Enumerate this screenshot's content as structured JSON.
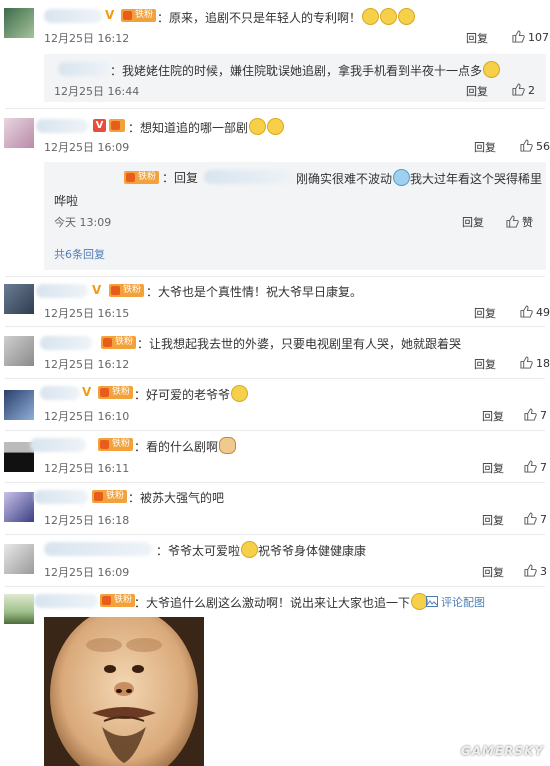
{
  "comments": [
    {
      "text": "：原来，追剧不只是年轻人的专利啊！",
      "time": "12月25日 16:12",
      "reply": "回复",
      "likes": "107"
    },
    {
      "sub_text": "：我姥姥住院的时候，嫌住院耽误她追剧，拿我手机看到半夜十一点多",
      "sub_time": "12月25日 16:44",
      "reply": "回复",
      "likes": "2"
    },
    {
      "text": "：想知道追的哪一部剧",
      "time": "12月25日 16:09",
      "reply": "回复",
      "likes": "56"
    },
    {
      "sub_line1_a": "：回复",
      "sub_line1_b": "刚确实很难不波动",
      "sub_line1_c": "我大过年看这个哭得稀里",
      "sub_line2": "哗啦",
      "sub_time": "今天 13:09",
      "reply": "回复",
      "likes": "赞",
      "more": "共6条回复"
    },
    {
      "text": "：大爷也是个真性情！祝大爷早日康复。",
      "time": "12月25日 16:15",
      "reply": "回复",
      "likes": "49"
    },
    {
      "text": "：让我想起我去世的外婆，只要电视剧里有人哭，她就跟着哭",
      "time": "12月25日 16:12",
      "reply": "回复",
      "likes": "18"
    },
    {
      "text": "：好可爱的老爷爷",
      "time": "12月25日 16:10",
      "reply": "回复",
      "likes": "7"
    },
    {
      "text": "：看的什么剧啊",
      "time": "12月25日 16:11",
      "reply": "回复",
      "likes": "7"
    },
    {
      "text": "：被苏大强气的吧",
      "time": "12月25日 16:18",
      "reply": "回复",
      "likes": "7"
    },
    {
      "text_a": "：爷爷太可爱啦",
      "text_b": "祝爷爷身体健健康康",
      "time": "12月25日 16:09",
      "reply": "回复",
      "likes": "3"
    },
    {
      "text": "：大爷追什么剧这么激动啊！说出来让大家也追一下",
      "pic_link": "评论配图"
    }
  ],
  "fan_label": "铁粉",
  "watermark": "GAMERSKY",
  "icons": [
    "thumbs-up-icon",
    "verified-v-icon",
    "fan-badge-icon",
    "crying-laugh-emoji",
    "laugh-emoji",
    "shy-emoji",
    "crying-emoji",
    "dog-emoji",
    "image-icon"
  ]
}
